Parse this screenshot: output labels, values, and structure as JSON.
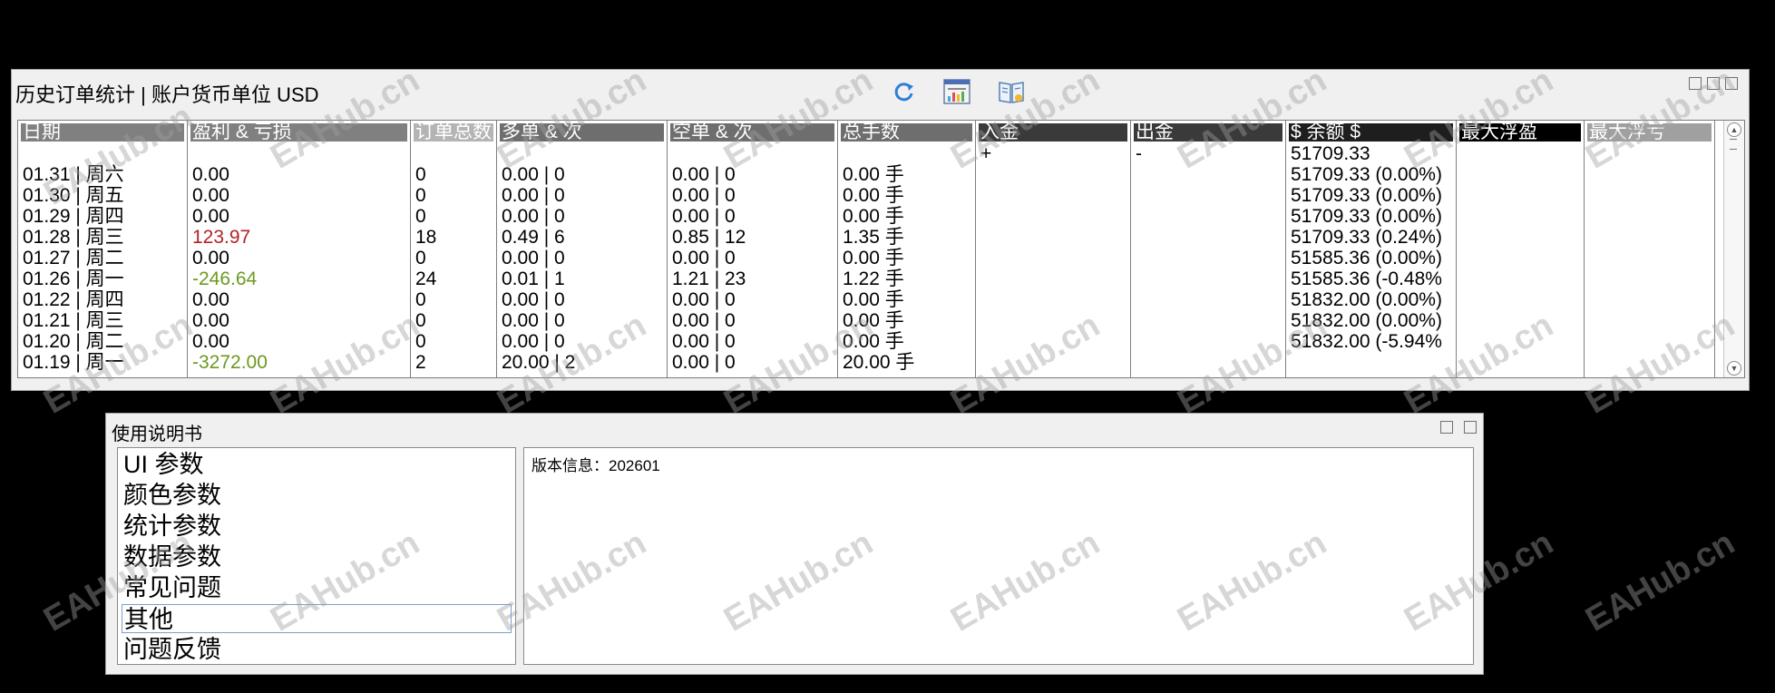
{
  "stats_panel": {
    "title": "历史订单统计 | 账户货币单位 USD",
    "toolbar": {
      "refresh_icon": "refresh-icon",
      "chart_icon": "chart-report-icon",
      "book_icon": "book-icon"
    },
    "columns": [
      {
        "key": "date",
        "header": "日期",
        "header_bg": "#808080",
        "cells": [
          "",
          "01.31 | 周六",
          "01.30 | 周五",
          "01.29 | 周四",
          "01.28 | 周三",
          "01.27 | 周二",
          "01.26 | 周一",
          "01.22 | 周四",
          "01.21 | 周三",
          "01.20 | 周二",
          "01.19 | 周一"
        ]
      },
      {
        "key": "profit_loss",
        "header": "盈利 & 亏损",
        "header_bg": "#808080",
        "cells": [
          "",
          "0.00",
          "0.00",
          "0.00",
          "123.97",
          "0.00",
          "-246.64",
          "0.00",
          "0.00",
          "0.00",
          "-3272.00"
        ]
      },
      {
        "key": "order_count",
        "header": "订单总数",
        "header_bg": "#b4b4b4",
        "cells": [
          "",
          "0",
          "0",
          "0",
          "18",
          "0",
          "24",
          "0",
          "0",
          "0",
          "2"
        ]
      },
      {
        "key": "long_orders",
        "header": "多单 & 次",
        "header_bg": "#6e6e6e",
        "cells": [
          "",
          "0.00 | 0",
          "0.00 | 0",
          "0.00 | 0",
          "0.49 | 6",
          "0.00 | 0",
          "0.01 | 1",
          "0.00 | 0",
          "0.00 | 0",
          "0.00 | 0",
          "20.00 | 2"
        ]
      },
      {
        "key": "short_orders",
        "header": "空单 & 次",
        "header_bg": "#6e6e6e",
        "cells": [
          "",
          "0.00 | 0",
          "0.00 | 0",
          "0.00 | 0",
          "0.85 | 12",
          "0.00 | 0",
          "1.21 | 23",
          "0.00 | 0",
          "0.00 | 0",
          "0.00 | 0",
          "0.00 | 0"
        ]
      },
      {
        "key": "total_lots",
        "header": "总手数",
        "header_bg": "#6e6e6e",
        "cells": [
          "",
          "0.00  手",
          "0.00  手",
          "0.00  手",
          "1.35  手",
          "0.00  手",
          "1.22  手",
          "0.00  手",
          "0.00  手",
          "0.00  手",
          "20.00  手"
        ]
      },
      {
        "key": "deposit",
        "header": "入金",
        "header_bg": "#3a3a3a",
        "cells": [
          "+"
        ]
      },
      {
        "key": "withdrawal",
        "header": "出金",
        "header_bg": "#3a3a3a",
        "cells": [
          "-"
        ]
      },
      {
        "key": "balance",
        "header": "$ 余额 $",
        "header_bg": "#1e1e1e",
        "cells": [
          "51709.33",
          "51709.33 (0.00%)",
          "51709.33 (0.00%)",
          "51709.33 (0.00%)",
          "51709.33 (0.24%)",
          "51585.36 (0.00%)",
          "51585.36 (-0.48%",
          "51832.00 (0.00%)",
          "51832.00 (0.00%)",
          "51832.00 (-5.94%"
        ]
      },
      {
        "key": "max_floating_profit",
        "header": "最大浮盈",
        "header_bg": "#000000",
        "cells": []
      },
      {
        "key": "max_floating_loss",
        "header": "最大浮亏",
        "header_bg": "#a0a0a0",
        "cells": []
      }
    ],
    "colors": {
      "profit": "#b22222",
      "loss": "#6b9a1e"
    }
  },
  "manual_panel": {
    "title": "使用说明书",
    "menu_items": [
      "UI 参数",
      "颜色参数",
      "统计参数",
      "数据参数",
      "常见问题",
      "其他",
      "问题反馈"
    ],
    "selected_index": 5,
    "version_info": "版本信息：202601"
  },
  "watermark_text": "EAHub.cn"
}
